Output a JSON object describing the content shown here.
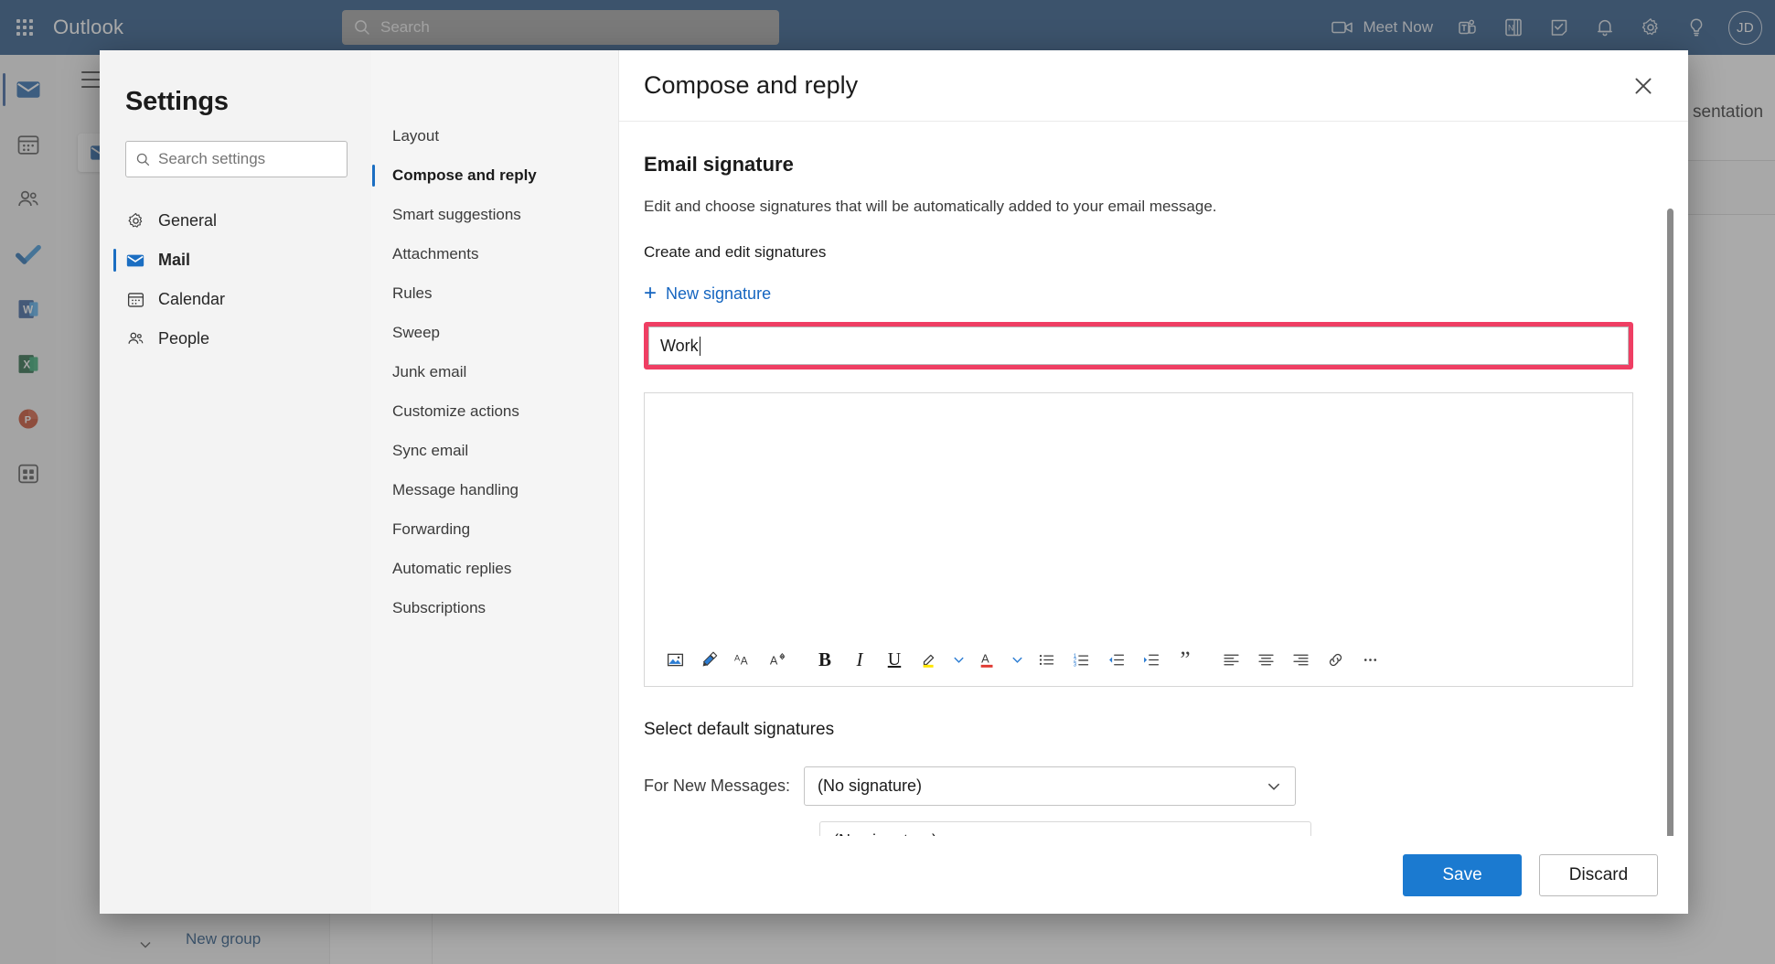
{
  "topbar": {
    "waffle_label": "App launcher",
    "brand": "Outlook",
    "search_placeholder": "Search",
    "meet_now_label": "Meet Now",
    "icons": [
      "video-camera-icon",
      "teams-icon",
      "onenote-icon",
      "todo-icon",
      "bell-icon",
      "gear-icon",
      "lightbulb-icon"
    ],
    "avatar_initials": "JD"
  },
  "rail": {
    "items": [
      {
        "name": "mail",
        "label": "Mail",
        "active": true
      },
      {
        "name": "calendar",
        "label": "Calendar",
        "active": false
      },
      {
        "name": "people",
        "label": "People",
        "active": false
      },
      {
        "name": "todo",
        "label": "To Do",
        "active": false
      },
      {
        "name": "word",
        "label": "Word",
        "active": false
      },
      {
        "name": "excel",
        "label": "Excel",
        "active": false
      },
      {
        "name": "powerpoint",
        "label": "PowerPoint",
        "active": false
      },
      {
        "name": "all-apps",
        "label": "All apps",
        "active": false
      }
    ]
  },
  "background": {
    "new_group_label": "New group",
    "reading_pane_title": "sentation"
  },
  "settings": {
    "title": "Settings",
    "search_placeholder": "Search settings",
    "categories": [
      {
        "label": "General",
        "icon": "gear-icon",
        "active": false
      },
      {
        "label": "Mail",
        "icon": "mail-icon",
        "active": true
      },
      {
        "label": "Calendar",
        "icon": "calendar-icon",
        "active": false
      },
      {
        "label": "People",
        "icon": "people-icon",
        "active": false
      }
    ],
    "subnav": [
      {
        "label": "Layout",
        "active": false
      },
      {
        "label": "Compose and reply",
        "active": true
      },
      {
        "label": "Smart suggestions",
        "active": false
      },
      {
        "label": "Attachments",
        "active": false
      },
      {
        "label": "Rules",
        "active": false
      },
      {
        "label": "Sweep",
        "active": false
      },
      {
        "label": "Junk email",
        "active": false
      },
      {
        "label": "Customize actions",
        "active": false
      },
      {
        "label": "Sync email",
        "active": false
      },
      {
        "label": "Message handling",
        "active": false
      },
      {
        "label": "Forwarding",
        "active": false
      },
      {
        "label": "Automatic replies",
        "active": false
      },
      {
        "label": "Subscriptions",
        "active": false
      }
    ]
  },
  "detail": {
    "header_title": "Compose and reply",
    "close_label": "Close",
    "section_title": "Email signature",
    "section_desc": "Edit and choose signatures that will be automatically added to your email message.",
    "create_label": "Create and edit signatures",
    "new_signature_label": "New signature",
    "signature_name_value": "Work",
    "signature_body_value": "",
    "toolbar": [
      {
        "name": "insert-picture-icon",
        "label": "Insert picture"
      },
      {
        "name": "format-painter-icon",
        "label": "Format painter"
      },
      {
        "name": "font-family-icon",
        "label": "Font"
      },
      {
        "name": "font-size-icon",
        "label": "Font size"
      },
      {
        "name": "bold-icon",
        "label": "Bold"
      },
      {
        "name": "italic-icon",
        "label": "Italic"
      },
      {
        "name": "underline-icon",
        "label": "Underline"
      },
      {
        "name": "highlight-icon",
        "label": "Highlight"
      },
      {
        "name": "highlight-chevron-down-icon",
        "label": "Highlight options"
      },
      {
        "name": "font-color-icon",
        "label": "Font color"
      },
      {
        "name": "font-color-chevron-down-icon",
        "label": "Font color options"
      },
      {
        "name": "bulleted-list-icon",
        "label": "Bulleted list"
      },
      {
        "name": "numbered-list-icon",
        "label": "Numbered list"
      },
      {
        "name": "decrease-indent-icon",
        "label": "Decrease indent"
      },
      {
        "name": "increase-indent-icon",
        "label": "Increase indent"
      },
      {
        "name": "quote-icon",
        "label": "Quote"
      },
      {
        "name": "align-left-icon",
        "label": "Align left"
      },
      {
        "name": "align-center-icon",
        "label": "Align center"
      },
      {
        "name": "align-right-icon",
        "label": "Align right"
      },
      {
        "name": "insert-link-icon",
        "label": "Insert link"
      },
      {
        "name": "more-options-icon",
        "label": "More options"
      }
    ],
    "defaults_title": "Select default signatures",
    "new_messages_label": "For New Messages:",
    "new_messages_value": "(No signature)",
    "dropdown_option_ghost": "(No signature)",
    "save_label": "Save",
    "discard_label": "Discard"
  },
  "colors": {
    "brand_blue": "#1b4a7d",
    "accent_blue": "#1b6ec2",
    "primary_button": "#1b7ad0",
    "link_blue": "#1565c0",
    "highlight_outline": "#ef3e63",
    "highlighter_yellow": "#ffe600",
    "font_color_red": "#e03a33"
  }
}
